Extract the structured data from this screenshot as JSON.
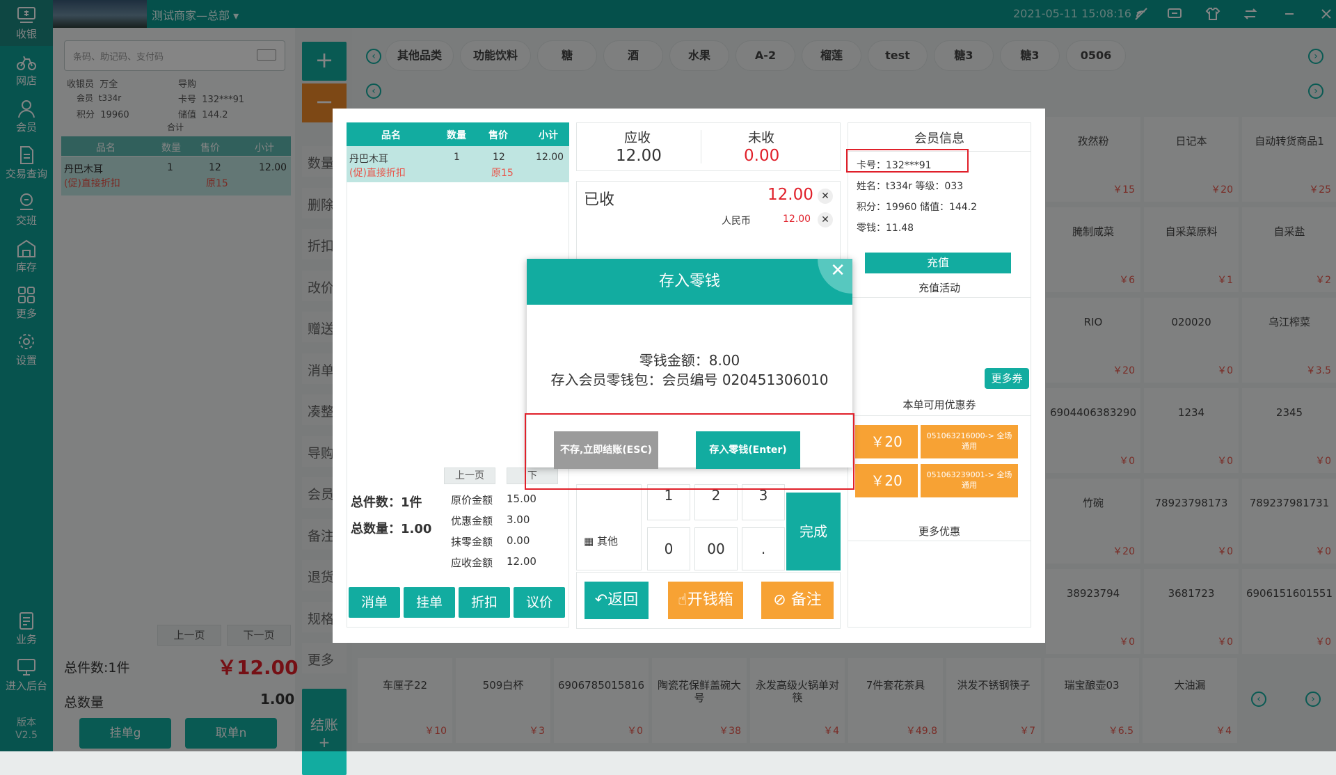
{
  "nav": {
    "items": [
      {
        "label": "收银",
        "icon": "cash-register-icon"
      },
      {
        "label": "网店",
        "icon": "bike-icon"
      },
      {
        "label": "会员",
        "icon": "user-icon"
      },
      {
        "label": "交易查询",
        "icon": "document-icon"
      },
      {
        "label": "交班",
        "icon": "handover-icon"
      },
      {
        "label": "库存",
        "icon": "warehouse-icon"
      },
      {
        "label": "更多",
        "icon": "grid-icon"
      },
      {
        "label": "设置",
        "icon": "gear-icon"
      },
      {
        "label": "业务",
        "icon": "clipboard-icon"
      },
      {
        "label": "进入后台",
        "icon": "monitor-icon"
      }
    ],
    "version": "版本\nV2.5"
  },
  "topbar": {
    "store": "测试商家—总部",
    "datetime": "2021-05-11 15:08:16"
  },
  "cart": {
    "scan_placeholder": "条码、助记码、支付码",
    "cashier_label": "收银员",
    "cashier": "万全",
    "guide_label": "导购",
    "member_label": "会员",
    "member": "t334r",
    "card_label": "卡号",
    "card": "132***91",
    "points_label": "积分",
    "points": "19960",
    "stored_label": "储值",
    "stored": "144.2",
    "sum_label": "合计",
    "columns": [
      "品名",
      "数量",
      "售价",
      "小计"
    ],
    "row": {
      "name": "丹巴木耳",
      "promo": "(促)直接折扣",
      "qty": "1",
      "price": "12",
      "orig": "原15",
      "subtotal": "12.00"
    },
    "prev": "上一页",
    "next": "下一页",
    "total_items_label": "总件数:1件",
    "total_amount": "￥12.00",
    "total_qty_label": "总数量",
    "total_qty": "1.00",
    "hold_btn": "挂单g",
    "fetch_btn": "取单n"
  },
  "actions": [
    "数量",
    "删除",
    "折扣",
    "改价",
    "赠送",
    "消单",
    "凑整",
    "导购",
    "会员",
    "备注",
    "退货",
    "规格",
    "更多"
  ],
  "checkout": {
    "label": "结账",
    "plus": "+"
  },
  "categories": [
    "其他品类",
    "功能饮料",
    "糖",
    "酒",
    "水果",
    "A-2",
    "榴莲",
    "test",
    "糖3",
    "糖3",
    "0506"
  ],
  "tiles": [
    {
      "name": "孜然粉",
      "price": "￥15"
    },
    {
      "name": "日记本",
      "price": "￥20"
    },
    {
      "name": "自动转货商品1",
      "price": "￥25"
    },
    {
      "name": "腌制咸菜",
      "price": "￥6"
    },
    {
      "name": "自采菜原料",
      "price": "￥1"
    },
    {
      "name": "自采盐",
      "price": "￥2"
    },
    {
      "name": "RIO",
      "price": "￥20"
    },
    {
      "name": "020020",
      "price": "￥0"
    },
    {
      "name": "乌江榨菜",
      "price": "￥3.5"
    },
    {
      "name": "6904406383290",
      "price": "￥0"
    },
    {
      "name": "1234",
      "price": "￥0"
    },
    {
      "name": "2345",
      "price": "￥0"
    },
    {
      "name": "竹碗",
      "price": "￥20"
    },
    {
      "name": "78923798173",
      "price": "￥0"
    },
    {
      "name": "789237981731",
      "price": "￥0"
    },
    {
      "name": "38923794",
      "price": "￥0"
    },
    {
      "name": "3681723",
      "price": "￥0"
    },
    {
      "name": "6906151601551",
      "price": "￥0"
    }
  ],
  "bottom_tiles": [
    {
      "name": "车厘子22",
      "price": "￥10"
    },
    {
      "name": "509白杯",
      "price": "￥3"
    },
    {
      "name": "6906785015816",
      "price": "￥0"
    },
    {
      "name": "陶瓷花保鲜盖碗大号",
      "price": "￥38"
    },
    {
      "name": "永发高级火锅单对筷",
      "price": "￥4"
    },
    {
      "name": "7件套花茶具",
      "price": "￥49.8"
    },
    {
      "name": "洪发不锈钢筷子",
      "price": "￥7"
    },
    {
      "name": "瑞宝酿壶03",
      "price": "￥6.5"
    },
    {
      "name": "大油漏",
      "price": "￥4"
    }
  ],
  "dialog": {
    "columns": [
      "品名",
      "数量",
      "售价",
      "小计"
    ],
    "row": {
      "name": "丹巴木耳",
      "promo": "(促)直接折扣",
      "qty": "1",
      "price": "12",
      "orig": "原15",
      "subtotal": "12.00"
    },
    "prev": "上一页",
    "next": "下",
    "total_items_label": "总件数：1件",
    "total_qty_label": "总数量：1.00",
    "summary": [
      {
        "label": "原价金额",
        "value": "15.00"
      },
      {
        "label": "优惠金额",
        "value": "3.00"
      },
      {
        "label": "抹零金额",
        "value": "0.00"
      },
      {
        "label": "应收金额",
        "value": "12.00"
      }
    ],
    "left_btns": [
      "消单",
      "挂单",
      "折扣",
      "议价"
    ],
    "receivable_label": "应收",
    "receivable": "12.00",
    "unpaid_label": "未收",
    "unpaid": "0.00",
    "paid_label": "已收",
    "paid": "12.00",
    "rmb_label": "人民币",
    "rmb": "12.00",
    "keys": [
      "1",
      "2",
      "3",
      "0",
      "00",
      "."
    ],
    "other_label": "其他",
    "done": "完成",
    "back": "返回",
    "cashbox": "开钱箱",
    "remark": "备注",
    "member_title": "会员信息",
    "card": "卡号：132***91",
    "name_line": "姓名：t334r  等级：033",
    "points_line": "积分：19960  储值：144.2",
    "change_line": "零钱：11.48",
    "recharge": "充值",
    "recharge_act": "充值活动",
    "more_coupons": "更多券",
    "available": "本单可用优惠券",
    "coupons": [
      {
        "amount": "￥20",
        "code": "051063216000-> 全场通用"
      },
      {
        "amount": "￥20",
        "code": "051063239001-> 全场通用"
      }
    ],
    "more_offers": "更多优惠"
  },
  "popup": {
    "title": "存入零钱",
    "change_line": "零钱金额：8.00",
    "deposit_line": "存入会员零钱包：会员编号 020451306010",
    "skip": "不存,立即结账(ESC)",
    "save": "存入零钱(Enter)"
  },
  "colors": {
    "teal": "#12aca0",
    "orange": "#f7a234",
    "red": "#e0202a"
  }
}
